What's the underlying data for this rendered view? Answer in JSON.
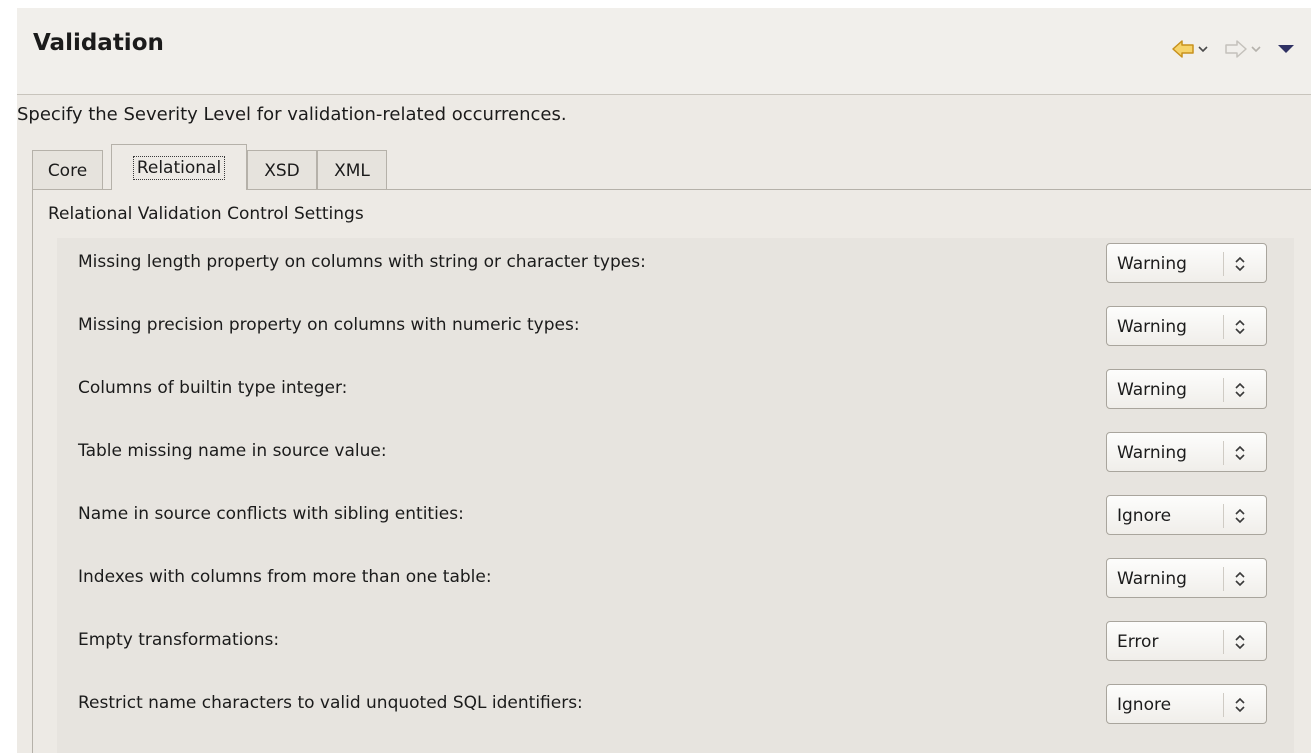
{
  "header": {
    "title": "Validation",
    "nav": {
      "back_icon": "back-arrow-icon",
      "forward_icon": "forward-arrow-icon",
      "menu_icon": "view-menu-icon",
      "accent_color": "#e8b73a",
      "menu_color": "#2f3163"
    }
  },
  "description": "Specify the Severity Level for validation-related occurrences.",
  "tabs": [
    {
      "label": "Core",
      "active": false
    },
    {
      "label": "Relational",
      "active": true
    },
    {
      "label": "XSD",
      "active": false
    },
    {
      "label": "XML",
      "active": false
    }
  ],
  "group": {
    "title": "Relational Validation Control Settings",
    "settings": [
      {
        "label": "Missing length property on columns with string or character types:",
        "value": "Warning"
      },
      {
        "label": "Missing precision property on columns with numeric types:",
        "value": "Warning"
      },
      {
        "label": "Columns of builtin type integer:",
        "value": "Warning"
      },
      {
        "label": "Table missing name in source value:",
        "value": "Warning"
      },
      {
        "label": "Name in source conflicts with sibling entities:",
        "value": "Ignore"
      },
      {
        "label": "Indexes with columns from more than one table:",
        "value": "Warning"
      },
      {
        "label": "Empty transformations:",
        "value": "Error"
      },
      {
        "label": "Restrict name characters to valid unquoted SQL identifiers:",
        "value": "Ignore"
      }
    ]
  }
}
